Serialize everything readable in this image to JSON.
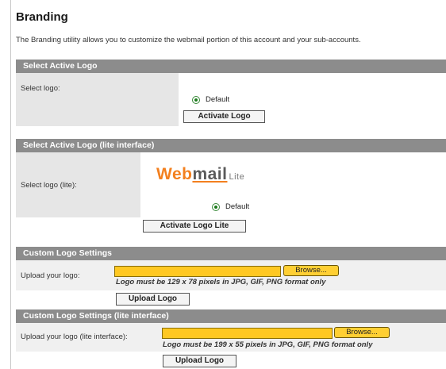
{
  "page": {
    "title": "Branding",
    "description": "The Branding utility allows you to customize the webmail portion of this account and your sub-accounts."
  },
  "select_active_logo": {
    "header": "Select Active Logo",
    "label": "Select logo:",
    "option": "Default",
    "button": "Activate Logo"
  },
  "select_active_logo_lite": {
    "header": "Select Active Logo (lite interface)",
    "label": "Select logo (lite):",
    "logo_text_web": "Web",
    "logo_text_mail": "mail",
    "logo_text_lite": "Lite",
    "option": "Default",
    "button": "Activate Logo Lite"
  },
  "custom_logo": {
    "header": "Custom Logo Settings",
    "label": "Upload your logo:",
    "browse": "Browse...",
    "hint": "Logo must be 129 x 78 pixels in JPG, GIF, PNG format only",
    "button": "Upload Logo"
  },
  "custom_logo_lite": {
    "header": "Custom Logo Settings (lite interface)",
    "label": "Upload your logo (lite interface):",
    "browse": "Browse...",
    "hint": "Logo must be 199 x 55 pixels in JPG, GIF, PNG format only",
    "button": "Upload Logo"
  },
  "colors": {
    "section_header": "#8c8c8c",
    "label_bg": "#e6e6e6",
    "file_input": "#ffc822",
    "logo_orange": "#f3801f"
  }
}
